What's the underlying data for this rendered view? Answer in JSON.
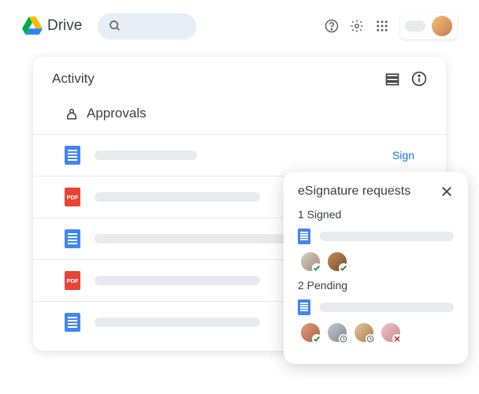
{
  "header": {
    "product": "Drive"
  },
  "activity": {
    "title": "Activity",
    "approvals_label": "Approvals",
    "sign_action": "Sign",
    "files": [
      {
        "type": "doc",
        "width": "w1",
        "action": "sign"
      },
      {
        "type": "pdf",
        "width": "w2"
      },
      {
        "type": "doc",
        "width": "w3"
      },
      {
        "type": "pdf",
        "width": "w2"
      },
      {
        "type": "doc",
        "width": "w2"
      }
    ]
  },
  "popup": {
    "title": "eSignature requests",
    "sections": [
      {
        "label": "1 Signed",
        "avatars": [
          {
            "color": "a1",
            "status": "check"
          },
          {
            "color": "a2",
            "status": "check"
          }
        ]
      },
      {
        "label": "2 Pending",
        "avatars": [
          {
            "color": "a3",
            "status": "check"
          },
          {
            "color": "a4",
            "status": "clock"
          },
          {
            "color": "a5",
            "status": "clock"
          },
          {
            "color": "a6",
            "status": "cross"
          }
        ]
      }
    ]
  }
}
